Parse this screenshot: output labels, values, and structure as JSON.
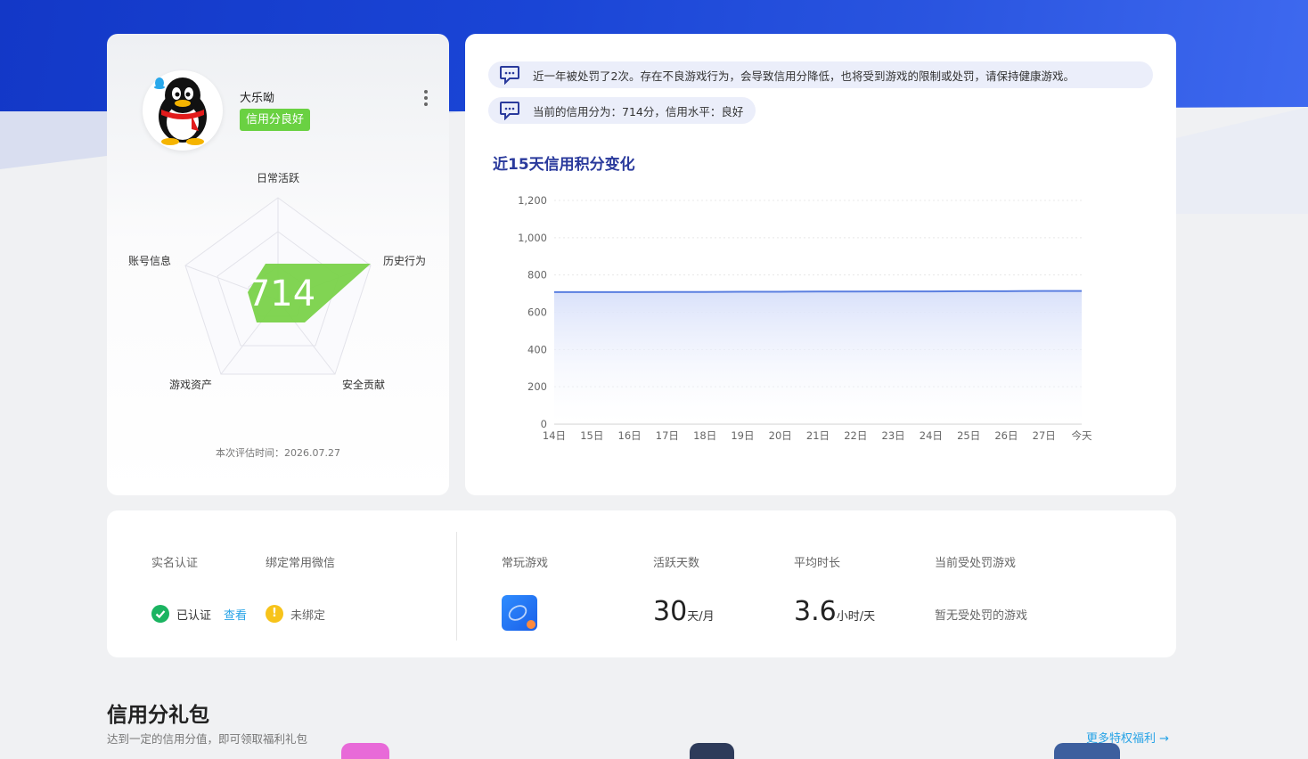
{
  "profile": {
    "username": "大乐呦",
    "credit_badge": "信用分良好",
    "score": "714",
    "eval_time": "本次评估时间：2026.07.27",
    "radar_labels": {
      "daily": "日常活跃",
      "history": "历史行为",
      "security": "安全贡献",
      "assets": "游戏资产",
      "account": "账号信息"
    }
  },
  "notices": {
    "punish": "近一年被处罚了2次。存在不良游戏行为，会导致信用分降低，也将受到游戏的限制或处罚，请保持健康游戏。",
    "current": "当前的信用分为：714分，信用水平：良好"
  },
  "chart_title": "近15天信用积分变化",
  "chart_data": {
    "type": "area",
    "categories": [
      "14日",
      "15日",
      "16日",
      "17日",
      "18日",
      "19日",
      "20日",
      "21日",
      "22日",
      "23日",
      "24日",
      "25日",
      "26日",
      "27日",
      "今天"
    ],
    "series": [
      {
        "values": [
          708,
          708,
          708,
          709,
          709,
          710,
          710,
          711,
          711,
          712,
          712,
          713,
          713,
          714,
          714
        ]
      }
    ],
    "yticks": [
      "0",
      "200",
      "400",
      "600",
      "800",
      "1,000",
      "1,200"
    ],
    "ylim": [
      0,
      1200
    ],
    "grid": true,
    "colors": {
      "line": "#5b7fe0",
      "fill": "#dfe6fb"
    }
  },
  "stats": {
    "realname_label": "实名认证",
    "wechat_label": "绑定常用微信",
    "realname_status": "已认证",
    "realname_view": "查看",
    "wechat_status": "未绑定",
    "frequent_game_label": "常玩游戏",
    "active_days_label": "活跃天数",
    "active_days_value": "30",
    "active_days_unit": "天/月",
    "avg_time_label": "平均时长",
    "avg_time_value": "3.6",
    "avg_time_unit": "小时/天",
    "penalty_game_label": "当前受处罚游戏",
    "penalty_game_value": "暂无受处罚的游戏"
  },
  "gift": {
    "title": "信用分礼包",
    "subtitle": "达到一定的信用分值，即可领取福利礼包",
    "more": "更多特权福利 →"
  }
}
